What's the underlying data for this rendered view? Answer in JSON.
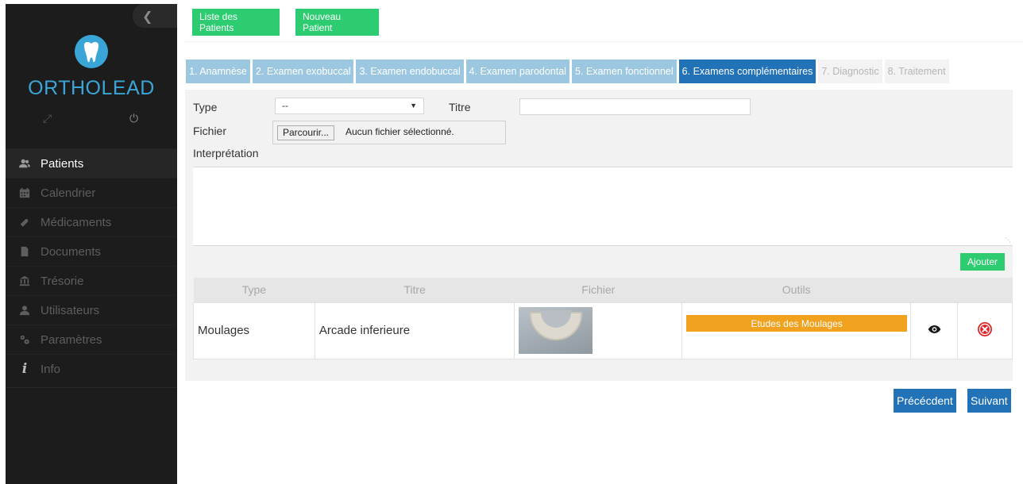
{
  "app": {
    "brand": "ORTHOLEAD"
  },
  "sidebar": {
    "items": [
      {
        "label": "Patients",
        "icon": "users-icon",
        "active": true
      },
      {
        "label": "Calendrier",
        "icon": "calendar-icon"
      },
      {
        "label": "Médicaments",
        "icon": "pill-icon"
      },
      {
        "label": "Documents",
        "icon": "document-icon"
      },
      {
        "label": "Trésorie",
        "icon": "bank-icon"
      },
      {
        "label": "Utilisateurs",
        "icon": "user-icon"
      },
      {
        "label": "Paramètres",
        "icon": "gears-icon"
      },
      {
        "label": "Info",
        "icon": "info-icon"
      }
    ]
  },
  "toolbar": {
    "list_label": "Liste des Patients",
    "new_label": "Nouveau Patient"
  },
  "tabs": [
    {
      "label": "1. Anamnèse",
      "state": "enabled"
    },
    {
      "label": "2. Examen exobuccal",
      "state": "enabled"
    },
    {
      "label": "3. Examen endobuccal",
      "state": "enabled"
    },
    {
      "label": "4. Examen parodontal",
      "state": "enabled"
    },
    {
      "label": "5. Examen fonctionnel",
      "state": "enabled"
    },
    {
      "label": "6. Examens complémentaires",
      "state": "active"
    },
    {
      "label": "7. Diagnostic",
      "state": "disabled"
    },
    {
      "label": "8. Traitement",
      "state": "disabled"
    }
  ],
  "form": {
    "type_label": "Type",
    "type_value": "--",
    "titre_label": "Titre",
    "titre_value": "",
    "fichier_label": "Fichier",
    "browse_label": "Parcourir...",
    "file_status": "Aucun fichier sélectionné.",
    "interpretation_label": "Interprétation",
    "add_label": "Ajouter"
  },
  "table": {
    "headers": [
      "Type",
      "Titre",
      "Fichier",
      "Outils"
    ],
    "rows": [
      {
        "type": "Moulages",
        "titre": "Arcade inferieure",
        "tool_label": "Etudes des Moulages"
      }
    ]
  },
  "nav": {
    "prev_label": "Précécdent",
    "next_label": "Suivant"
  },
  "colors": {
    "green": "#2ecc71",
    "blue_active": "#2272b8",
    "blue_tab": "#9cc7e0",
    "orange": "#f0a21e",
    "danger": "#e0262b",
    "brand": "#3aa6d8"
  }
}
